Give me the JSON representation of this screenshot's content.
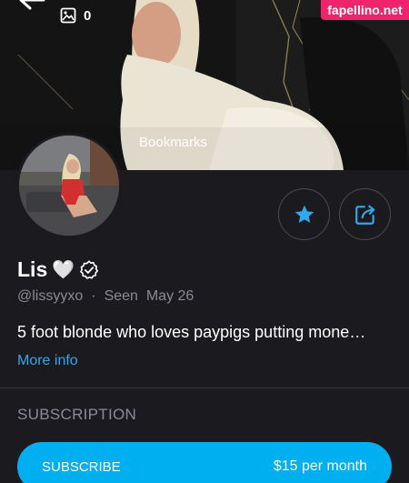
{
  "header": {
    "media_count": "0",
    "cover_label": "Bookmarks",
    "watermark": "fapellino.net"
  },
  "profile": {
    "name": "Lis",
    "name_emoji": "🤍",
    "handle": "@lissyyxo",
    "separator": "·",
    "last_seen": "Seen  May 26",
    "bio": "5 foot blonde who loves paypigs putting mone…",
    "more_info": "More info"
  },
  "subscription": {
    "section_title": "SUBSCRIPTION",
    "button_label": "SUBSCRIBE",
    "price": "$15 per month"
  },
  "colors": {
    "accent": "#00aff0",
    "link": "#2fa8ee",
    "background": "#1b1b1f",
    "muted_text": "#8a8a94",
    "watermark": "#f0246a"
  },
  "icons": [
    "back-arrow-icon",
    "image-icon",
    "star-icon",
    "share-icon",
    "verified-icon"
  ]
}
